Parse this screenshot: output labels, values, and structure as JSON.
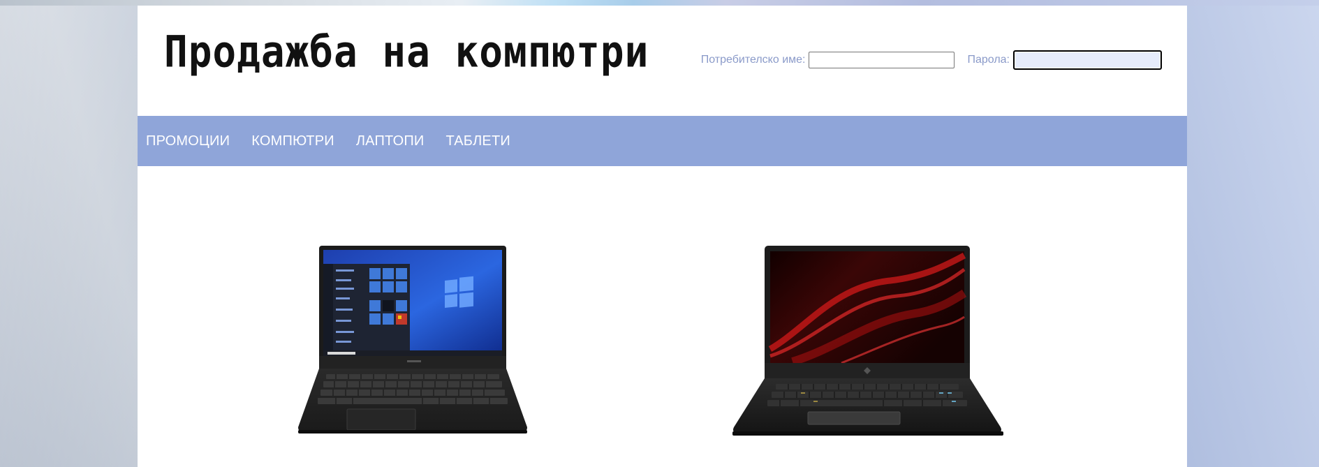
{
  "header": {
    "title": "Продажба на компютри"
  },
  "login": {
    "username_label": "Потребителско име:",
    "username_value": "",
    "password_label": "Парола:",
    "password_value": ""
  },
  "nav": {
    "items": [
      {
        "label": "ПРОМОЦИИ"
      },
      {
        "label": "КОМПЮТРИ"
      },
      {
        "label": "ЛАПТОПИ"
      },
      {
        "label": "ТАБЛЕТИ"
      }
    ]
  },
  "products": [
    {
      "image": "laptop-windows-image"
    },
    {
      "image": "gaming-laptop-image"
    }
  ],
  "colors": {
    "nav_background": "#8fa5d9",
    "label_color": "#8a9ac9",
    "page_background": "#ffffff"
  }
}
